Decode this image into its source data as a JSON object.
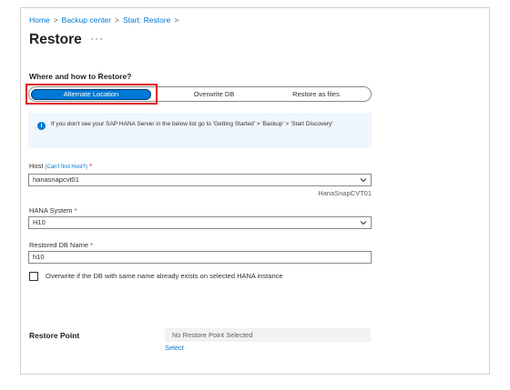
{
  "breadcrumb": {
    "home": "Home",
    "backup_center": "Backup center",
    "start_restore": "Start: Restore",
    "separator": ">"
  },
  "page": {
    "title": "Restore",
    "more_label": "···"
  },
  "restore_target": {
    "heading": "Where and how to Restore?",
    "options": [
      "Alternate Location",
      "Overwrite DB",
      "Restore as files"
    ],
    "selected": "Alternate Location"
  },
  "info": {
    "icon": "info-icon",
    "text": "If you don't see your SAP HANA Server in the below list go to 'Getting Started' > 'Backup' > 'Start Discovery'"
  },
  "host": {
    "label": "Host",
    "link": "(Can't find Host?)",
    "required": "*",
    "value": "hanasnapcvt01",
    "hint": "HanaSnapCVT01"
  },
  "hana_system": {
    "label": "HANA System",
    "required": "*",
    "value": "H10"
  },
  "restored_db": {
    "label": "Restored DB Name",
    "required": "*",
    "value": "h10"
  },
  "overwrite_checkbox": {
    "label": "Overwrite if the DB with same name already exists on selected HANA instance",
    "checked": false
  },
  "restore_point": {
    "label": "Restore Point",
    "value": "No Restore Point Selected",
    "link": "Select"
  },
  "colors": {
    "accent": "#0078d4",
    "required": "#a4262c",
    "highlight": "#e81123",
    "info_bg": "#eff6fc"
  }
}
